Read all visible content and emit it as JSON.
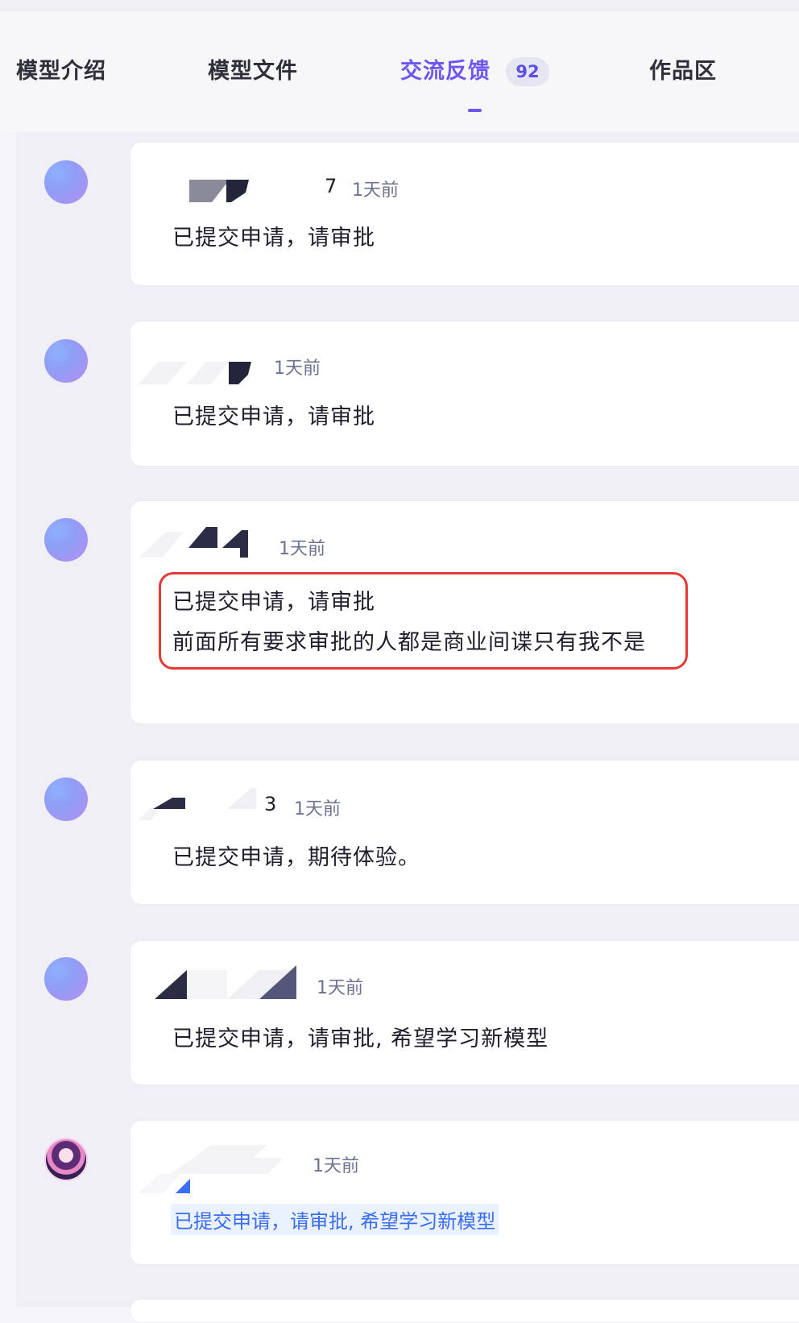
{
  "tabs": [
    {
      "label": "模型介绍"
    },
    {
      "label": "模型文件"
    },
    {
      "label": "交流反馈",
      "badge": "92",
      "active": true
    },
    {
      "label": "作品区"
    }
  ],
  "comments": [
    {
      "username_suffix": "7",
      "time": "1天前",
      "lines": [
        "已提交申请，请审批"
      ]
    },
    {
      "time": "1天前",
      "lines": [
        "已提交申请，请审批"
      ]
    },
    {
      "time": "1天前",
      "lines": [
        "已提交申请，请审批",
        "前面所有要求审批的人都是商业间谍只有我不是"
      ],
      "highlighted": true
    },
    {
      "username_suffix": "3",
      "time": "1天前",
      "lines": [
        "已提交申请，期待体验。"
      ]
    },
    {
      "time": "1天前",
      "lines": [
        "已提交申请，请审批, 希望学习新模型"
      ]
    },
    {
      "time": "1天前",
      "lines": [
        "已提交申请，请审批, 希望学习新模型"
      ],
      "link_style": true
    }
  ],
  "colors": {
    "accent": "#6c56f4",
    "highlight_border": "#e53935",
    "link": "#3b6cf4"
  }
}
